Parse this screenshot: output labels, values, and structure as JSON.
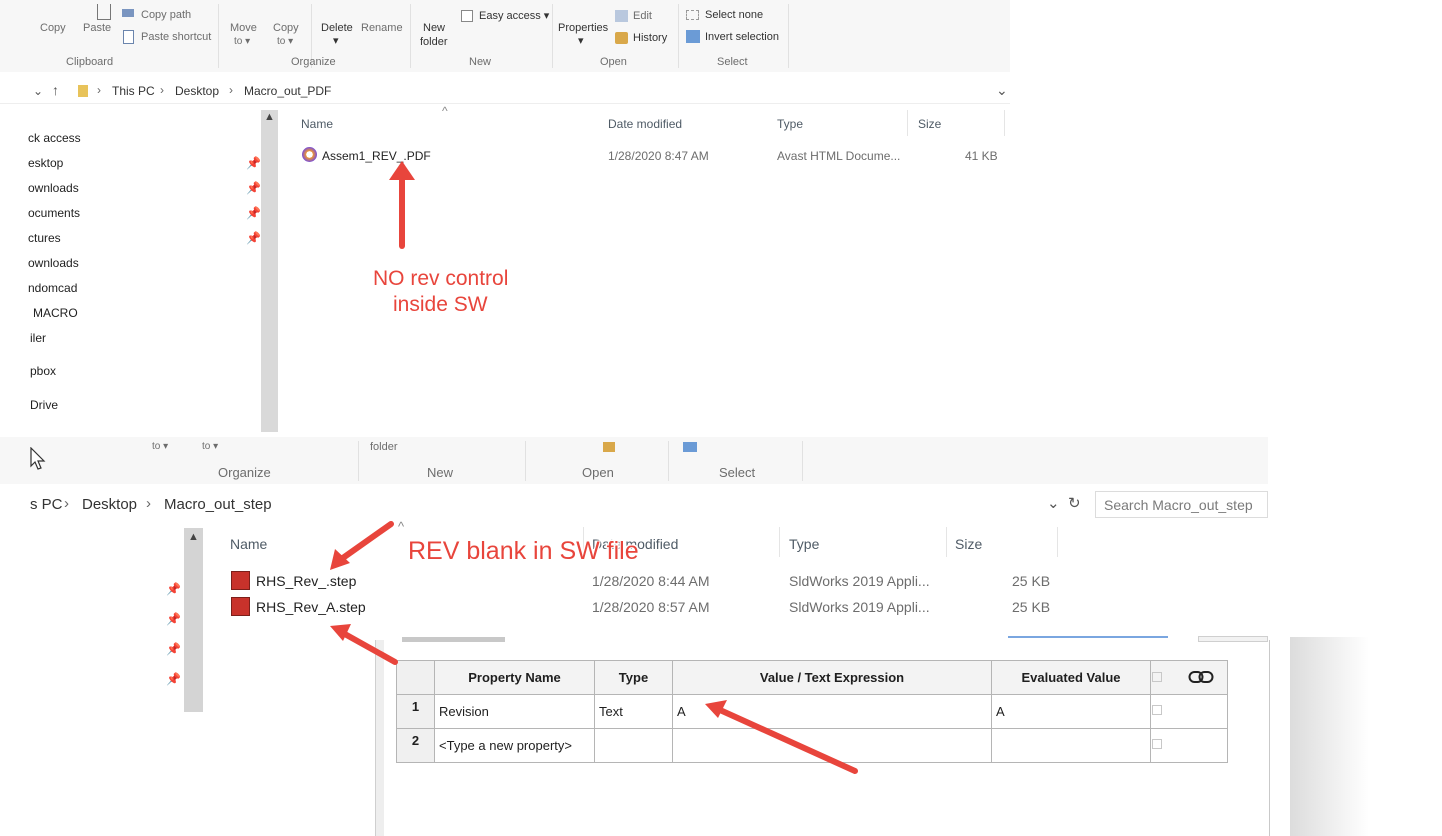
{
  "top_explorer": {
    "ribbon": {
      "clipboard": {
        "copy": "Copy",
        "paste": "Paste",
        "copy_path": "Copy path",
        "paste_shortcut": "Paste shortcut",
        "label": "Clipboard"
      },
      "organize": {
        "move_to_1": "Move",
        "move_to_2": "to ▾",
        "copy_to_1": "Copy",
        "copy_to_2": "to ▾",
        "delete": "Delete",
        "rename": "Rename",
        "label": "Organize"
      },
      "new": {
        "new_folder_1": "New",
        "new_folder_2": "folder",
        "easy_access": "Easy access ▾",
        "label": "New"
      },
      "open": {
        "properties": "Properties",
        "edit": "Edit",
        "history": "History",
        "label": "Open"
      },
      "select": {
        "select_none": "Select none",
        "invert": "Invert selection",
        "label": "Select"
      }
    },
    "breadcrumb": [
      "This PC",
      "Desktop",
      "Macro_out_PDF"
    ],
    "nav_items": [
      "ck access",
      "esktop",
      "ownloads",
      "ocuments",
      "ctures",
      "ownloads",
      "ndomcad",
      "MACRO",
      "iler",
      "pbox",
      "Drive"
    ],
    "columns": {
      "name": "Name",
      "date": "Date modified",
      "type": "Type",
      "size": "Size"
    },
    "files": [
      {
        "name": "Assem1_REV_.PDF",
        "date": "1/28/2020 8:47 AM",
        "type": "Avast HTML Docume...",
        "size": "41 KB"
      }
    ]
  },
  "bottom_explorer": {
    "ribbon": {
      "organize": "Organize",
      "new": "New",
      "open": "Open",
      "select": "Select",
      "folder_partial": "folder"
    },
    "breadcrumb": [
      "s PC",
      "Desktop",
      "Macro_out_step"
    ],
    "search_placeholder": "Search Macro_out_step",
    "columns": {
      "name": "Name",
      "date": "Date modified",
      "type": "Type",
      "size": "Size"
    },
    "files": [
      {
        "name": "RHS_Rev_.step",
        "date": "1/28/2020 8:44 AM",
        "type": "SldWorks 2019 Appli...",
        "size": "25 KB"
      },
      {
        "name": "RHS_Rev_A.step",
        "date": "1/28/2020 8:57 AM",
        "type": "SldWorks 2019 Appli...",
        "size": "25 KB"
      }
    ]
  },
  "property_table": {
    "headers": {
      "property_name": "Property Name",
      "type": "Type",
      "value": "Value / Text Expression",
      "evaluated": "Evaluated Value"
    },
    "rows": [
      {
        "num": "1",
        "name": "Revision",
        "type": "Text",
        "value": "A",
        "evaluated": "A"
      },
      {
        "num": "2",
        "name": "<Type a new property>",
        "type": "",
        "value": "",
        "evaluated": ""
      }
    ]
  },
  "annotations": {
    "no_rev_line1": "NO rev control",
    "no_rev_line2": "inside SW",
    "rev_blank": "REV blank in SW file"
  },
  "colors": {
    "annotation": "#e8453c",
    "ribbon_bg": "#f7f7f7"
  }
}
